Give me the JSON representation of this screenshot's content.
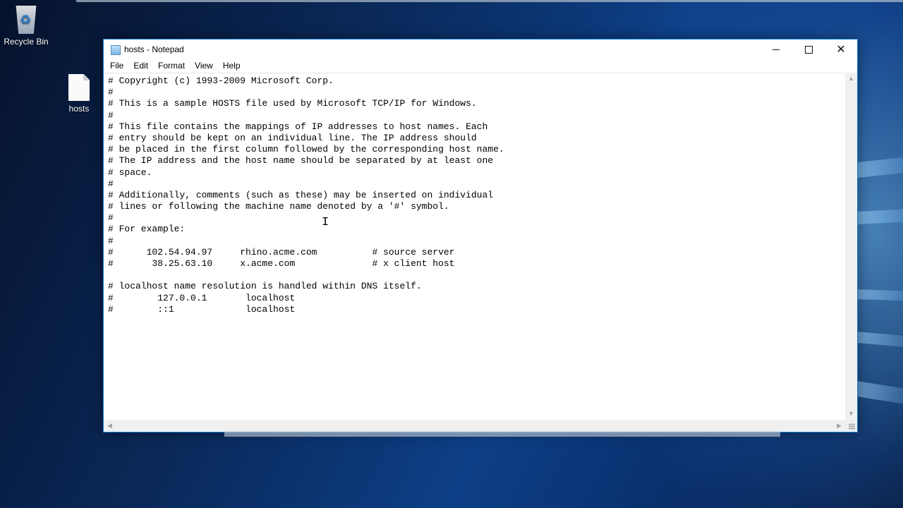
{
  "desktop": {
    "icons": [
      {
        "label": "Recycle Bin",
        "icon": "recycle-bin-icon"
      },
      {
        "label": "hosts",
        "icon": "file-icon"
      }
    ]
  },
  "window": {
    "title": "hosts - Notepad",
    "icon": "notepad-icon",
    "controls": {
      "minimize": "minimize-icon",
      "maximize": "maximize-icon",
      "close": "close-icon"
    },
    "menu": [
      "File",
      "Edit",
      "Format",
      "View",
      "Help"
    ]
  },
  "document": {
    "lines": [
      "# Copyright (c) 1993-2009 Microsoft Corp.",
      "#",
      "# This is a sample HOSTS file used by Microsoft TCP/IP for Windows.",
      "#",
      "# This file contains the mappings of IP addresses to host names. Each",
      "# entry should be kept on an individual line. The IP address should",
      "# be placed in the first column followed by the corresponding host name.",
      "# The IP address and the host name should be separated by at least one",
      "# space.",
      "#",
      "# Additionally, comments (such as these) may be inserted on individual",
      "# lines or following the machine name denoted by a '#' symbol.",
      "#",
      "# For example:",
      "#",
      "#      102.54.94.97     rhino.acme.com          # source server",
      "#       38.25.63.10     x.acme.com              # x client host",
      "",
      "# localhost name resolution is handled within DNS itself.",
      "#\t127.0.0.1       localhost",
      "#\t::1             localhost"
    ]
  },
  "colors": {
    "window_border": "#1883d7",
    "editor_bg": "#ffffff",
    "text": "#000000"
  }
}
